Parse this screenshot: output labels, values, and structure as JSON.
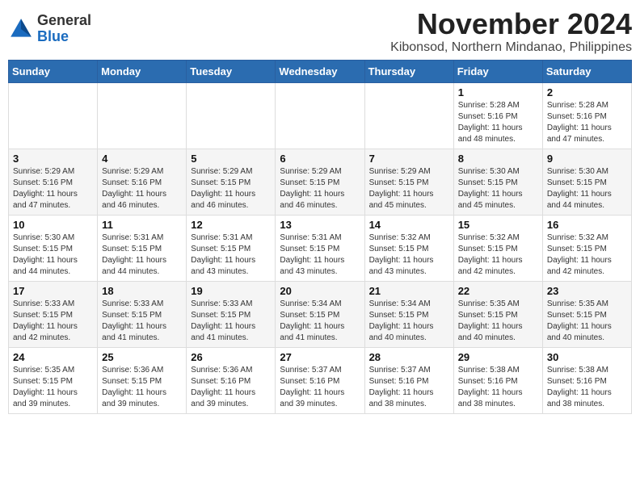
{
  "header": {
    "logo_line1": "General",
    "logo_line2": "Blue",
    "title": "November 2024",
    "subtitle": "Kibonsod, Northern Mindanao, Philippines"
  },
  "weekdays": [
    "Sunday",
    "Monday",
    "Tuesday",
    "Wednesday",
    "Thursday",
    "Friday",
    "Saturday"
  ],
  "weeks": [
    [
      {
        "day": "",
        "sunrise": "",
        "sunset": "",
        "daylight": ""
      },
      {
        "day": "",
        "sunrise": "",
        "sunset": "",
        "daylight": ""
      },
      {
        "day": "",
        "sunrise": "",
        "sunset": "",
        "daylight": ""
      },
      {
        "day": "",
        "sunrise": "",
        "sunset": "",
        "daylight": ""
      },
      {
        "day": "",
        "sunrise": "",
        "sunset": "",
        "daylight": ""
      },
      {
        "day": "1",
        "sunrise": "Sunrise: 5:28 AM",
        "sunset": "Sunset: 5:16 PM",
        "daylight": "Daylight: 11 hours and 48 minutes."
      },
      {
        "day": "2",
        "sunrise": "Sunrise: 5:28 AM",
        "sunset": "Sunset: 5:16 PM",
        "daylight": "Daylight: 11 hours and 47 minutes."
      }
    ],
    [
      {
        "day": "3",
        "sunrise": "Sunrise: 5:29 AM",
        "sunset": "Sunset: 5:16 PM",
        "daylight": "Daylight: 11 hours and 47 minutes."
      },
      {
        "day": "4",
        "sunrise": "Sunrise: 5:29 AM",
        "sunset": "Sunset: 5:16 PM",
        "daylight": "Daylight: 11 hours and 46 minutes."
      },
      {
        "day": "5",
        "sunrise": "Sunrise: 5:29 AM",
        "sunset": "Sunset: 5:15 PM",
        "daylight": "Daylight: 11 hours and 46 minutes."
      },
      {
        "day": "6",
        "sunrise": "Sunrise: 5:29 AM",
        "sunset": "Sunset: 5:15 PM",
        "daylight": "Daylight: 11 hours and 46 minutes."
      },
      {
        "day": "7",
        "sunrise": "Sunrise: 5:29 AM",
        "sunset": "Sunset: 5:15 PM",
        "daylight": "Daylight: 11 hours and 45 minutes."
      },
      {
        "day": "8",
        "sunrise": "Sunrise: 5:30 AM",
        "sunset": "Sunset: 5:15 PM",
        "daylight": "Daylight: 11 hours and 45 minutes."
      },
      {
        "day": "9",
        "sunrise": "Sunrise: 5:30 AM",
        "sunset": "Sunset: 5:15 PM",
        "daylight": "Daylight: 11 hours and 44 minutes."
      }
    ],
    [
      {
        "day": "10",
        "sunrise": "Sunrise: 5:30 AM",
        "sunset": "Sunset: 5:15 PM",
        "daylight": "Daylight: 11 hours and 44 minutes."
      },
      {
        "day": "11",
        "sunrise": "Sunrise: 5:31 AM",
        "sunset": "Sunset: 5:15 PM",
        "daylight": "Daylight: 11 hours and 44 minutes."
      },
      {
        "day": "12",
        "sunrise": "Sunrise: 5:31 AM",
        "sunset": "Sunset: 5:15 PM",
        "daylight": "Daylight: 11 hours and 43 minutes."
      },
      {
        "day": "13",
        "sunrise": "Sunrise: 5:31 AM",
        "sunset": "Sunset: 5:15 PM",
        "daylight": "Daylight: 11 hours and 43 minutes."
      },
      {
        "day": "14",
        "sunrise": "Sunrise: 5:32 AM",
        "sunset": "Sunset: 5:15 PM",
        "daylight": "Daylight: 11 hours and 43 minutes."
      },
      {
        "day": "15",
        "sunrise": "Sunrise: 5:32 AM",
        "sunset": "Sunset: 5:15 PM",
        "daylight": "Daylight: 11 hours and 42 minutes."
      },
      {
        "day": "16",
        "sunrise": "Sunrise: 5:32 AM",
        "sunset": "Sunset: 5:15 PM",
        "daylight": "Daylight: 11 hours and 42 minutes."
      }
    ],
    [
      {
        "day": "17",
        "sunrise": "Sunrise: 5:33 AM",
        "sunset": "Sunset: 5:15 PM",
        "daylight": "Daylight: 11 hours and 42 minutes."
      },
      {
        "day": "18",
        "sunrise": "Sunrise: 5:33 AM",
        "sunset": "Sunset: 5:15 PM",
        "daylight": "Daylight: 11 hours and 41 minutes."
      },
      {
        "day": "19",
        "sunrise": "Sunrise: 5:33 AM",
        "sunset": "Sunset: 5:15 PM",
        "daylight": "Daylight: 11 hours and 41 minutes."
      },
      {
        "day": "20",
        "sunrise": "Sunrise: 5:34 AM",
        "sunset": "Sunset: 5:15 PM",
        "daylight": "Daylight: 11 hours and 41 minutes."
      },
      {
        "day": "21",
        "sunrise": "Sunrise: 5:34 AM",
        "sunset": "Sunset: 5:15 PM",
        "daylight": "Daylight: 11 hours and 40 minutes."
      },
      {
        "day": "22",
        "sunrise": "Sunrise: 5:35 AM",
        "sunset": "Sunset: 5:15 PM",
        "daylight": "Daylight: 11 hours and 40 minutes."
      },
      {
        "day": "23",
        "sunrise": "Sunrise: 5:35 AM",
        "sunset": "Sunset: 5:15 PM",
        "daylight": "Daylight: 11 hours and 40 minutes."
      }
    ],
    [
      {
        "day": "24",
        "sunrise": "Sunrise: 5:35 AM",
        "sunset": "Sunset: 5:15 PM",
        "daylight": "Daylight: 11 hours and 39 minutes."
      },
      {
        "day": "25",
        "sunrise": "Sunrise: 5:36 AM",
        "sunset": "Sunset: 5:15 PM",
        "daylight": "Daylight: 11 hours and 39 minutes."
      },
      {
        "day": "26",
        "sunrise": "Sunrise: 5:36 AM",
        "sunset": "Sunset: 5:16 PM",
        "daylight": "Daylight: 11 hours and 39 minutes."
      },
      {
        "day": "27",
        "sunrise": "Sunrise: 5:37 AM",
        "sunset": "Sunset: 5:16 PM",
        "daylight": "Daylight: 11 hours and 39 minutes."
      },
      {
        "day": "28",
        "sunrise": "Sunrise: 5:37 AM",
        "sunset": "Sunset: 5:16 PM",
        "daylight": "Daylight: 11 hours and 38 minutes."
      },
      {
        "day": "29",
        "sunrise": "Sunrise: 5:38 AM",
        "sunset": "Sunset: 5:16 PM",
        "daylight": "Daylight: 11 hours and 38 minutes."
      },
      {
        "day": "30",
        "sunrise": "Sunrise: 5:38 AM",
        "sunset": "Sunset: 5:16 PM",
        "daylight": "Daylight: 11 hours and 38 minutes."
      }
    ]
  ]
}
